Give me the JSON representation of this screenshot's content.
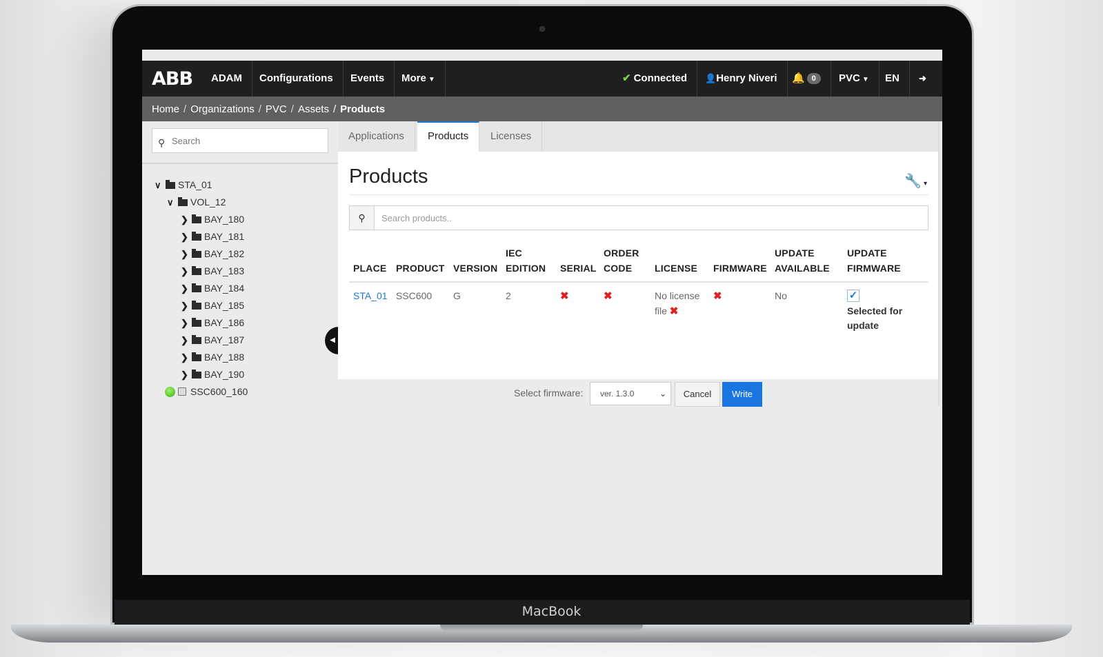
{
  "device": {
    "brand_label": "MacBook"
  },
  "app": {
    "logo": "ABB",
    "nav": [
      {
        "label": "ADAM"
      },
      {
        "label": "Configurations"
      },
      {
        "label": "Events"
      },
      {
        "label": "More",
        "has_caret": true
      }
    ],
    "right": {
      "connection_status": "Connected",
      "user_name": "Henry Niveri",
      "notification_count": "0",
      "org": "PVC",
      "language": "EN",
      "logout_icon": "logout-icon"
    },
    "colors": {
      "topbar": "#1f1f1f",
      "accent": "#1976e0",
      "connected": "#7ed04b",
      "error": "#e02020"
    }
  },
  "breadcrumb": {
    "items": [
      "Home",
      "Organizations",
      "PVC",
      "Assets"
    ],
    "current": "Products"
  },
  "sidebar": {
    "search_placeholder": "Search",
    "tree": [
      {
        "label": "STA_01",
        "level": 0,
        "expanded": true
      },
      {
        "label": "VOL_12",
        "level": 1,
        "expanded": true
      },
      {
        "label": "BAY_180",
        "level": 2,
        "expanded": false
      },
      {
        "label": "BAY_181",
        "level": 2,
        "expanded": false
      },
      {
        "label": "BAY_182",
        "level": 2,
        "expanded": false
      },
      {
        "label": "BAY_183",
        "level": 2,
        "expanded": false
      },
      {
        "label": "BAY_184",
        "level": 2,
        "expanded": false
      },
      {
        "label": "BAY_185",
        "level": 2,
        "expanded": false
      },
      {
        "label": "BAY_186",
        "level": 2,
        "expanded": false
      },
      {
        "label": "BAY_187",
        "level": 2,
        "expanded": false
      },
      {
        "label": "BAY_188",
        "level": 2,
        "expanded": false
      },
      {
        "label": "BAY_190",
        "level": 2,
        "expanded": false
      }
    ],
    "device": {
      "label": "SSC600_160",
      "status": "online"
    }
  },
  "tabs": [
    {
      "label": "Applications",
      "active": false
    },
    {
      "label": "Products",
      "active": true
    },
    {
      "label": "Licenses",
      "active": false
    }
  ],
  "main": {
    "title": "Products",
    "search_placeholder": "Search products..",
    "columns": {
      "place": "PLACE",
      "product": "PRODUCT",
      "version": "VERSION",
      "iec_edition_1": "IEC",
      "iec_edition_2": "EDITION",
      "serial": "SERIAL",
      "order_code_1": "ORDER",
      "order_code_2": "CODE",
      "license": "LICENSE",
      "firmware": "FIRMWARE",
      "update_available_1": "UPDATE",
      "update_available_2": "AVAILABLE",
      "update_firmware_1": "UPDATE",
      "update_firmware_2": "FIRMWARE"
    },
    "row": {
      "place": "STA_01",
      "product": "SSC600",
      "version": "G",
      "iec_edition": "2",
      "license_1": "No license",
      "license_2": "file",
      "update_available": "No",
      "update_checked": true,
      "selected_1": "Selected for",
      "selected_2": "update"
    }
  },
  "footer": {
    "select_label": "Select firmware:",
    "selected_version": "ver. 1.3.0",
    "cancel_label": "Cancel",
    "write_label": "Write"
  }
}
